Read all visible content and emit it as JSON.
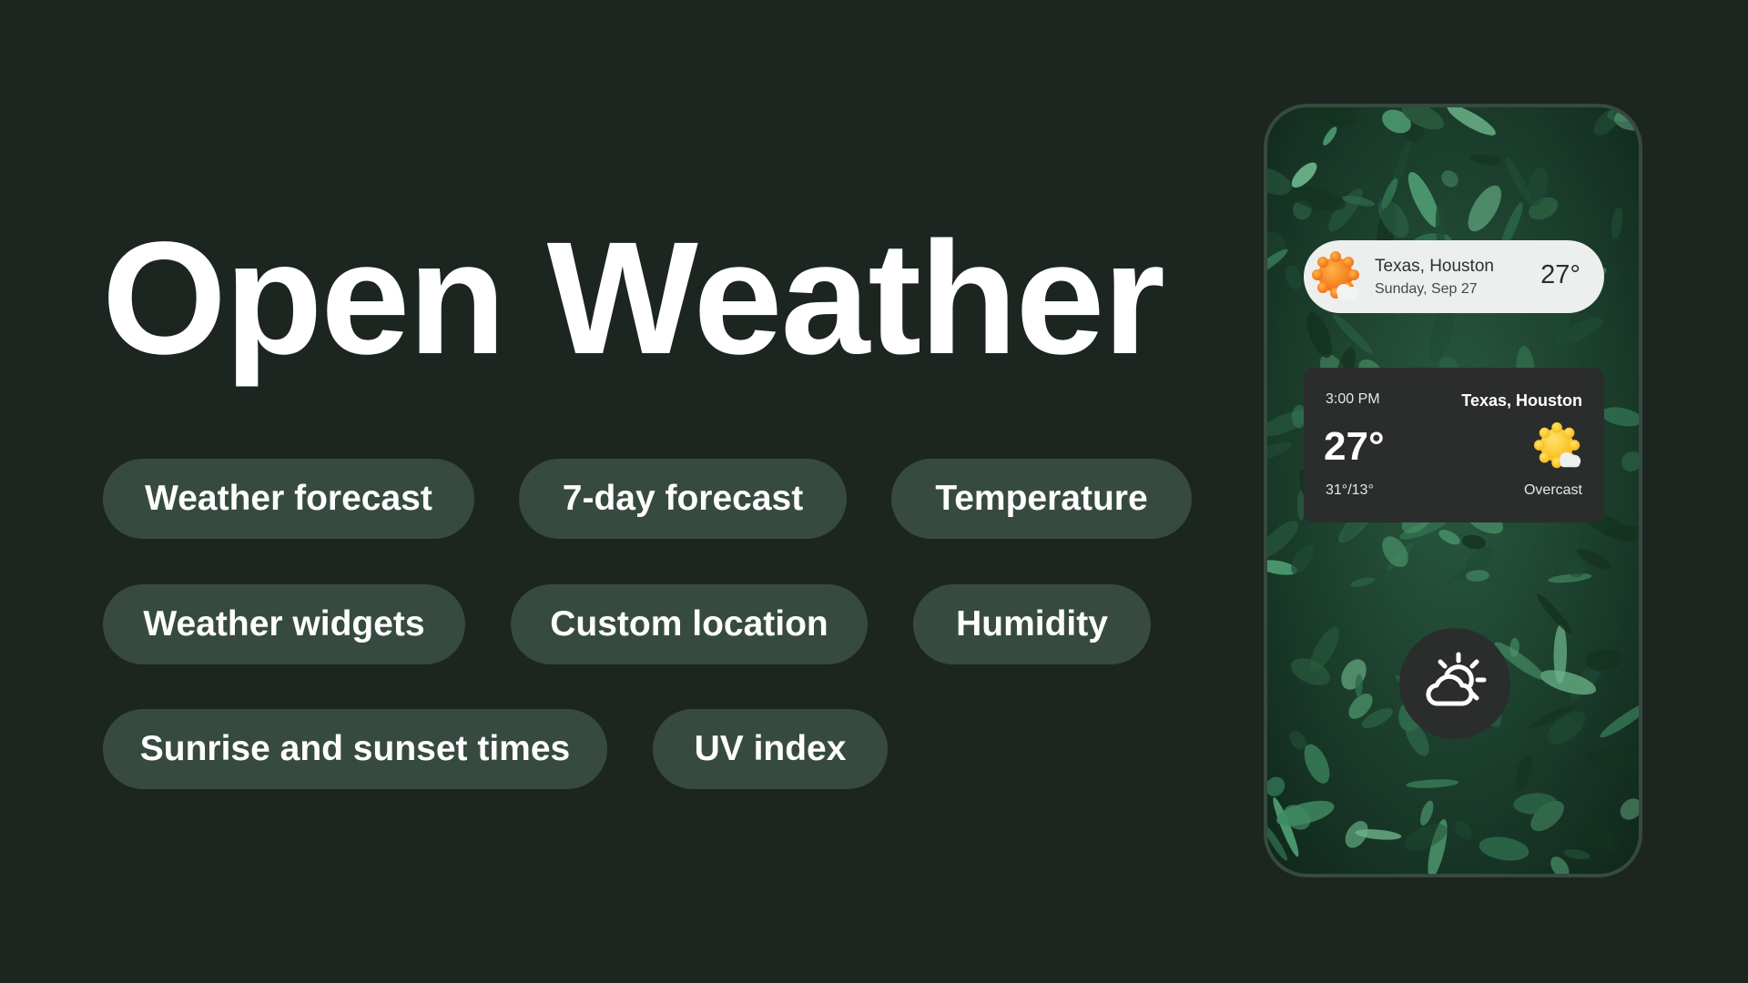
{
  "title": "Open Weather",
  "features": [
    "Weather forecast",
    "7-day forecast",
    "Temperature",
    "Weather widgets",
    "Custom location",
    "Humidity",
    "Sunrise and sunset times",
    "UV index"
  ],
  "phone": {
    "pill_widget": {
      "location": "Texas, Houston",
      "date": "Sunday, Sep 27",
      "temperature": "27°",
      "icon": "sun-cloud-icon"
    },
    "card_widget": {
      "time": "3:00 PM",
      "location": "Texas, Houston",
      "temperature": "27°",
      "range": "31°/13°",
      "condition": "Overcast",
      "icon": "sun-cloud-icon"
    },
    "app_icon": "partly-cloudy-icon"
  },
  "colors": {
    "background": "#1d2520",
    "chip": "#374a40",
    "widget_light": "#ecefee",
    "widget_dark": "#2b2d2c",
    "sun_orange": "#f7941d",
    "sun_yellow": "#fbc531"
  }
}
